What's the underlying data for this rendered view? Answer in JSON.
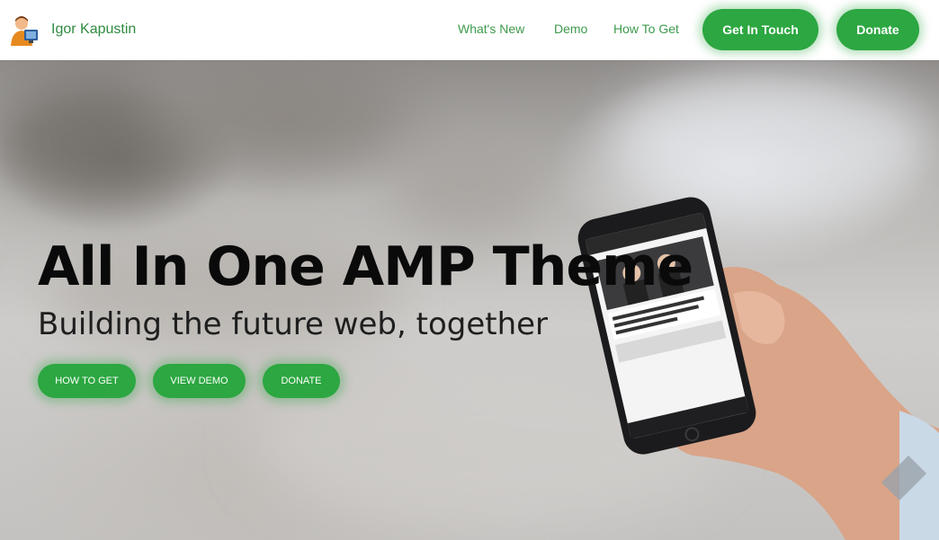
{
  "header": {
    "brand": {
      "name": "Igor Kapustin",
      "avatar_icon": "user-avatar-icon"
    },
    "nav": [
      {
        "label": "What's New"
      },
      {
        "label": "Demo"
      },
      {
        "label": "How To Get"
      }
    ],
    "buttons": {
      "contact_label": "Get In Touch",
      "donate_label": "Donate"
    }
  },
  "hero": {
    "title": "All In One AMP Theme",
    "subtitle": "Building the future web, together",
    "cta": [
      {
        "label": "HOW TO GET"
      },
      {
        "label": "VIEW DEMO"
      },
      {
        "label": "DONATE"
      }
    ],
    "phone_screen": {
      "headline": "Pressemelding årsresultat 2016: Solid verdiskaping for Aars"
    }
  },
  "colors": {
    "accent": "#2ca741",
    "nav_text": "#3e9a4c",
    "title_text": "#0a0a0a"
  }
}
